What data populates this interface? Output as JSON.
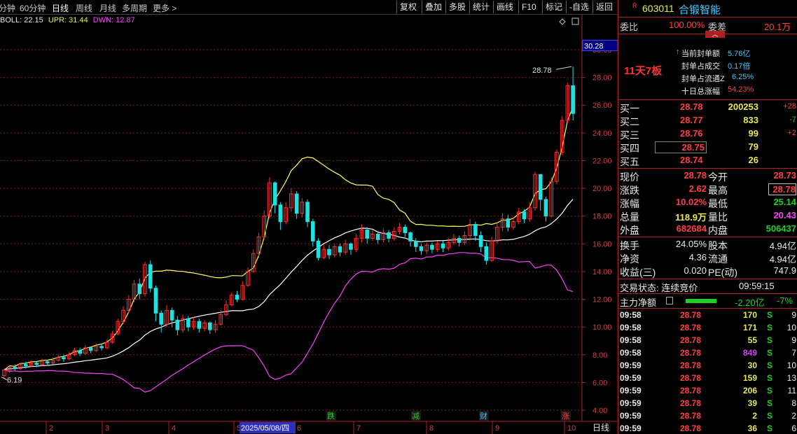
{
  "toolbar": {
    "periods": [
      "分钟",
      "60分钟",
      "日线",
      "周线",
      "月线",
      "多周期",
      "更多 >"
    ],
    "active_period": "日线",
    "actions": [
      "复权",
      "叠加",
      "多股",
      "统计",
      "画线",
      "F10",
      "标记",
      "-自选",
      "返回"
    ]
  },
  "indicator": {
    "label": "BOLL: 22.15",
    "upr": "UPR: 31.44",
    "dwn": "DWN: 12.87"
  },
  "chart": {
    "price_labels": [
      "30.00",
      "28.00",
      "26.00",
      "24.00",
      "22.00",
      "20.00",
      "18.00",
      "16.00",
      "14.00",
      "12.00",
      "10.00",
      "8.00",
      "6.00",
      "4.00"
    ],
    "current_price_box": "30.28",
    "high_label": "28.78",
    "low_label": "6.19",
    "date_ticks": [
      "2",
      "3",
      "4",
      "5",
      "6",
      "7",
      "8",
      "9",
      "10"
    ],
    "selected_date": "2025/05/08/四",
    "markers": [
      {
        "text": "跌",
        "color": "#20d020"
      },
      {
        "text": "减",
        "color": "#20d020"
      },
      {
        "text": "财",
        "color": "#40c8ff"
      },
      {
        "text": "涨",
        "color": "#ff4040"
      }
    ],
    "period_tab": "日线",
    "colors": {
      "up": "#ff3030",
      "down": "#20e0e0",
      "boll_mid": "#ffffff",
      "upr": "#ffff60",
      "dwn": "#ff40ff"
    }
  },
  "chart_data": {
    "type": "candlestick",
    "price_axis": {
      "min": 4,
      "max": 30,
      "step": 2
    },
    "series": [
      {
        "name": "BOLL",
        "value": 22.15
      },
      {
        "name": "UPR",
        "value": 31.44
      },
      {
        "name": "DWN",
        "value": 12.87
      }
    ],
    "candles": [
      [
        6.5,
        6.9,
        6.3,
        7.0
      ],
      [
        6.9,
        7.1,
        6.7,
        7.2
      ],
      [
        7.1,
        7.0,
        6.8,
        7.3
      ],
      [
        7.0,
        7.3,
        6.9,
        7.4
      ],
      [
        7.3,
        7.2,
        7.0,
        7.5
      ],
      [
        7.2,
        7.4,
        7.1,
        7.6
      ],
      [
        7.4,
        7.3,
        7.1,
        7.5
      ],
      [
        7.3,
        7.5,
        7.2,
        7.7
      ],
      [
        7.5,
        7.4,
        7.2,
        7.6
      ],
      [
        7.4,
        7.6,
        7.3,
        7.8
      ],
      [
        7.6,
        7.8,
        7.5,
        8.0
      ],
      [
        7.8,
        7.7,
        7.5,
        8.0
      ],
      [
        7.7,
        8.0,
        7.6,
        8.2
      ],
      [
        8.0,
        8.3,
        7.9,
        8.5
      ],
      [
        8.3,
        8.1,
        7.9,
        8.5
      ],
      [
        8.1,
        8.5,
        8.0,
        8.7
      ],
      [
        8.5,
        8.3,
        8.1,
        8.6
      ],
      [
        8.3,
        8.6,
        8.2,
        8.8
      ],
      [
        8.6,
        8.5,
        8.3,
        8.8
      ],
      [
        8.5,
        8.9,
        8.4,
        9.1
      ],
      [
        8.9,
        9.5,
        8.8,
        9.7
      ],
      [
        9.5,
        10.4,
        9.4,
        10.6
      ],
      [
        10.4,
        11.2,
        10.2,
        11.5
      ],
      [
        11.2,
        12.0,
        11.0,
        12.3
      ],
      [
        12.0,
        13.1,
        11.8,
        13.4
      ],
      [
        13.1,
        12.4,
        12.0,
        13.5
      ],
      [
        12.4,
        14.5,
        12.2,
        14.7
      ],
      [
        14.5,
        12.8,
        12.5,
        14.8
      ],
      [
        12.8,
        11.0,
        10.4,
        13.0
      ],
      [
        11.0,
        10.2,
        9.6,
        11.2
      ],
      [
        10.2,
        11.2,
        10.0,
        11.6
      ],
      [
        11.2,
        10.5,
        10.0,
        11.4
      ],
      [
        10.5,
        9.8,
        9.4,
        10.8
      ],
      [
        9.8,
        10.6,
        9.6,
        10.9
      ],
      [
        10.6,
        10.0,
        9.7,
        10.8
      ],
      [
        10.0,
        10.4,
        9.8,
        10.7
      ],
      [
        10.4,
        9.9,
        9.6,
        10.6
      ],
      [
        9.9,
        10.3,
        9.7,
        10.5
      ],
      [
        10.3,
        9.8,
        9.5,
        10.4
      ],
      [
        9.8,
        10.2,
        9.6,
        10.5
      ],
      [
        10.2,
        10.9,
        10.1,
        11.2
      ],
      [
        10.9,
        11.6,
        10.8,
        11.9
      ],
      [
        11.6,
        12.3,
        11.5,
        12.5
      ],
      [
        12.3,
        12.0,
        11.8,
        12.6
      ],
      [
        12.0,
        13.0,
        11.9,
        13.3
      ],
      [
        13.0,
        14.0,
        12.9,
        14.3
      ],
      [
        14.0,
        15.3,
        13.9,
        15.6
      ],
      [
        15.3,
        16.5,
        15.0,
        16.8
      ],
      [
        16.5,
        18.0,
        16.3,
        18.4
      ],
      [
        18.0,
        20.4,
        17.8,
        20.8
      ],
      [
        20.4,
        18.8,
        18.2,
        20.5
      ],
      [
        18.8,
        17.6,
        17.0,
        19.0
      ],
      [
        17.6,
        18.6,
        17.4,
        19.0
      ],
      [
        18.6,
        19.6,
        18.3,
        20.0
      ],
      [
        19.6,
        18.2,
        17.8,
        19.8
      ],
      [
        18.2,
        19.0,
        17.9,
        19.3
      ],
      [
        19.0,
        17.6,
        17.2,
        19.2
      ],
      [
        17.6,
        16.2,
        15.8,
        17.8
      ],
      [
        16.2,
        15.0,
        14.8,
        16.4
      ],
      [
        15.0,
        15.6,
        14.9,
        15.9
      ],
      [
        15.6,
        15.2,
        14.9,
        15.9
      ],
      [
        15.2,
        15.8,
        15.0,
        16.0
      ],
      [
        15.8,
        15.4,
        15.1,
        16.0
      ],
      [
        15.4,
        16.0,
        15.2,
        16.3
      ],
      [
        16.0,
        15.6,
        15.2,
        16.1
      ],
      [
        15.6,
        16.4,
        15.4,
        16.7
      ],
      [
        16.4,
        17.0,
        16.1,
        17.4
      ],
      [
        17.0,
        16.4,
        16.0,
        17.2
      ],
      [
        16.4,
        16.7,
        16.2,
        17.0
      ],
      [
        16.7,
        16.3,
        16.0,
        16.9
      ],
      [
        16.3,
        16.8,
        16.1,
        17.1
      ],
      [
        16.8,
        16.4,
        16.1,
        17.0
      ],
      [
        16.4,
        16.9,
        16.2,
        17.2
      ],
      [
        16.9,
        17.2,
        16.7,
        17.5
      ],
      [
        17.2,
        16.8,
        16.5,
        17.4
      ],
      [
        16.8,
        16.2,
        15.8,
        16.9
      ],
      [
        16.2,
        15.8,
        15.4,
        16.4
      ],
      [
        15.8,
        15.5,
        15.2,
        16.0
      ],
      [
        15.5,
        15.9,
        15.3,
        16.1
      ],
      [
        15.9,
        15.6,
        15.3,
        16.1
      ],
      [
        15.6,
        16.0,
        15.4,
        16.2
      ],
      [
        16.0,
        15.7,
        15.4,
        16.2
      ],
      [
        15.7,
        16.1,
        15.5,
        16.4
      ],
      [
        16.1,
        16.4,
        15.9,
        16.7
      ],
      [
        16.4,
        16.1,
        15.8,
        16.6
      ],
      [
        16.1,
        16.6,
        15.9,
        16.9
      ],
      [
        16.6,
        17.4,
        16.4,
        17.8
      ],
      [
        17.4,
        16.6,
        16.2,
        17.6
      ],
      [
        16.6,
        15.8,
        15.4,
        16.9
      ],
      [
        15.8,
        14.8,
        14.5,
        16.1
      ],
      [
        14.8,
        16.2,
        14.7,
        16.5
      ],
      [
        16.2,
        17.2,
        16.0,
        17.5
      ],
      [
        17.2,
        17.8,
        16.9,
        18.2
      ],
      [
        17.8,
        17.2,
        16.9,
        18.1
      ],
      [
        17.2,
        17.6,
        17.0,
        17.9
      ],
      [
        17.6,
        18.3,
        17.4,
        18.6
      ],
      [
        18.3,
        17.8,
        17.5,
        18.5
      ],
      [
        17.8,
        18.6,
        17.6,
        19.0
      ],
      [
        18.6,
        21.0,
        18.4,
        21.2
      ],
      [
        21.0,
        19.2,
        18.4,
        21.0
      ],
      [
        19.2,
        18.0,
        17.6,
        19.4
      ],
      [
        18.0,
        20.5,
        17.9,
        20.8
      ],
      [
        20.5,
        22.6,
        20.3,
        22.8
      ],
      [
        22.6,
        24.9,
        22.4,
        25.2
      ],
      [
        24.9,
        27.4,
        24.7,
        27.6
      ],
      [
        27.4,
        25.4,
        24.9,
        28.78
      ]
    ]
  },
  "panel": {
    "stock_code": "603011",
    "stock_name": "合锻智能",
    "weibi_label": "委比",
    "weibi_value": "100.00%",
    "weicha_label": "委差",
    "weicha_value": "20.1万",
    "board_text": "11天7板",
    "seal_info": [
      {
        "label": "当前封单额",
        "value": "5.76亿"
      },
      {
        "label": "封单占成交",
        "value": "0.17倍"
      },
      {
        "label": "封单占流通Z",
        "value": "6.25%"
      },
      {
        "label": "十日总涨幅",
        "value": "54.23%"
      }
    ],
    "bids": [
      {
        "label": "买一",
        "price": "28.78",
        "volume": "200253",
        "change": "+28"
      },
      {
        "label": "买二",
        "price": "28.77",
        "volume": "833",
        "change": "-7"
      },
      {
        "label": "买三",
        "price": "28.76",
        "volume": "99",
        "change": "+2"
      },
      {
        "label": "买四",
        "price": "28.75",
        "volume": "79",
        "change": ""
      },
      {
        "label": "买五",
        "price": "28.74",
        "volume": "26",
        "change": ""
      }
    ],
    "quote": [
      {
        "l1": "现价",
        "v1": "28.78",
        "l2": "今开",
        "v2": "28.73"
      },
      {
        "l1": "涨跌",
        "v1": "2.62",
        "l2": "最高",
        "v2": "28.78"
      },
      {
        "l1": "涨幅",
        "v1": "10.02%",
        "l2": "最低",
        "v2": "25.14"
      },
      {
        "l1": "总量",
        "v1": "118.9万",
        "l2": "量比",
        "v2": "20.43"
      },
      {
        "l1": "外盘",
        "v1": "682684",
        "l2": "内盘",
        "v2": "506437"
      }
    ],
    "fund": [
      {
        "l1": "换手",
        "v1": "24.05%",
        "l2": "股本",
        "v2": "4.94亿"
      },
      {
        "l1": "净资",
        "v1": "4.36",
        "l2": "流通",
        "v2": "4.94亿"
      },
      {
        "l1": "收益(三)",
        "v1": "0.020",
        "l2": "PE(动)",
        "v2": "747.9"
      }
    ],
    "trade_status": "交易状态: 连续竞价",
    "trade_time": "09:59:15",
    "main_flow_label": "主力净额",
    "main_flow_value": "-2.20亿",
    "main_flow_pct": "-7%",
    "ticks": [
      {
        "time": "09:58",
        "price": "28.78",
        "vol": "170",
        "side": "S",
        "num": "9"
      },
      {
        "time": "09:58",
        "price": "28.78",
        "vol": "171",
        "side": "S",
        "num": "10"
      },
      {
        "time": "09:58",
        "price": "28.78",
        "vol": "55",
        "side": "S",
        "num": "9"
      },
      {
        "time": "09:58",
        "price": "28.78",
        "vol": "849",
        "side": "S",
        "num": "7"
      },
      {
        "time": "09:59",
        "price": "28.78",
        "vol": "30",
        "side": "S",
        "num": "10"
      },
      {
        "time": "09:59",
        "price": "28.78",
        "vol": "159",
        "side": "S",
        "num": "13"
      },
      {
        "time": "09:59",
        "price": "28.78",
        "vol": "206",
        "side": "S",
        "num": "11"
      },
      {
        "time": "09:59",
        "price": "28.78",
        "vol": "39",
        "side": "S",
        "num": "8"
      },
      {
        "time": "09:59",
        "price": "28.78",
        "vol": "2",
        "side": "S",
        "num": "2"
      },
      {
        "time": "09:59",
        "price": "28.78",
        "vol": "36",
        "side": "S",
        "num": "6"
      }
    ]
  }
}
